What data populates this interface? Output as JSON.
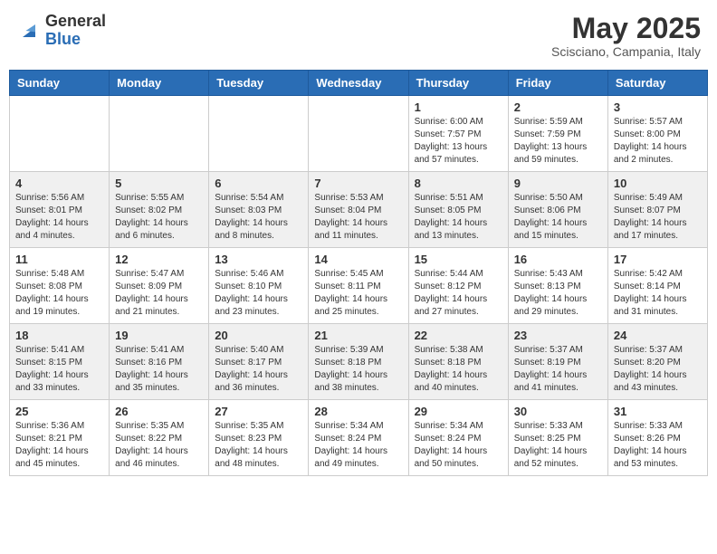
{
  "header": {
    "logo_general": "General",
    "logo_blue": "Blue",
    "month_year": "May 2025",
    "location": "Scisciano, Campania, Italy"
  },
  "calendar": {
    "days_of_week": [
      "Sunday",
      "Monday",
      "Tuesday",
      "Wednesday",
      "Thursday",
      "Friday",
      "Saturday"
    ],
    "weeks": [
      [
        {
          "day": "",
          "info": ""
        },
        {
          "day": "",
          "info": ""
        },
        {
          "day": "",
          "info": ""
        },
        {
          "day": "",
          "info": ""
        },
        {
          "day": "1",
          "info": "Sunrise: 6:00 AM\nSunset: 7:57 PM\nDaylight: 13 hours\nand 57 minutes."
        },
        {
          "day": "2",
          "info": "Sunrise: 5:59 AM\nSunset: 7:59 PM\nDaylight: 13 hours\nand 59 minutes."
        },
        {
          "day": "3",
          "info": "Sunrise: 5:57 AM\nSunset: 8:00 PM\nDaylight: 14 hours\nand 2 minutes."
        }
      ],
      [
        {
          "day": "4",
          "info": "Sunrise: 5:56 AM\nSunset: 8:01 PM\nDaylight: 14 hours\nand 4 minutes."
        },
        {
          "day": "5",
          "info": "Sunrise: 5:55 AM\nSunset: 8:02 PM\nDaylight: 14 hours\nand 6 minutes."
        },
        {
          "day": "6",
          "info": "Sunrise: 5:54 AM\nSunset: 8:03 PM\nDaylight: 14 hours\nand 8 minutes."
        },
        {
          "day": "7",
          "info": "Sunrise: 5:53 AM\nSunset: 8:04 PM\nDaylight: 14 hours\nand 11 minutes."
        },
        {
          "day": "8",
          "info": "Sunrise: 5:51 AM\nSunset: 8:05 PM\nDaylight: 14 hours\nand 13 minutes."
        },
        {
          "day": "9",
          "info": "Sunrise: 5:50 AM\nSunset: 8:06 PM\nDaylight: 14 hours\nand 15 minutes."
        },
        {
          "day": "10",
          "info": "Sunrise: 5:49 AM\nSunset: 8:07 PM\nDaylight: 14 hours\nand 17 minutes."
        }
      ],
      [
        {
          "day": "11",
          "info": "Sunrise: 5:48 AM\nSunset: 8:08 PM\nDaylight: 14 hours\nand 19 minutes."
        },
        {
          "day": "12",
          "info": "Sunrise: 5:47 AM\nSunset: 8:09 PM\nDaylight: 14 hours\nand 21 minutes."
        },
        {
          "day": "13",
          "info": "Sunrise: 5:46 AM\nSunset: 8:10 PM\nDaylight: 14 hours\nand 23 minutes."
        },
        {
          "day": "14",
          "info": "Sunrise: 5:45 AM\nSunset: 8:11 PM\nDaylight: 14 hours\nand 25 minutes."
        },
        {
          "day": "15",
          "info": "Sunrise: 5:44 AM\nSunset: 8:12 PM\nDaylight: 14 hours\nand 27 minutes."
        },
        {
          "day": "16",
          "info": "Sunrise: 5:43 AM\nSunset: 8:13 PM\nDaylight: 14 hours\nand 29 minutes."
        },
        {
          "day": "17",
          "info": "Sunrise: 5:42 AM\nSunset: 8:14 PM\nDaylight: 14 hours\nand 31 minutes."
        }
      ],
      [
        {
          "day": "18",
          "info": "Sunrise: 5:41 AM\nSunset: 8:15 PM\nDaylight: 14 hours\nand 33 minutes."
        },
        {
          "day": "19",
          "info": "Sunrise: 5:41 AM\nSunset: 8:16 PM\nDaylight: 14 hours\nand 35 minutes."
        },
        {
          "day": "20",
          "info": "Sunrise: 5:40 AM\nSunset: 8:17 PM\nDaylight: 14 hours\nand 36 minutes."
        },
        {
          "day": "21",
          "info": "Sunrise: 5:39 AM\nSunset: 8:18 PM\nDaylight: 14 hours\nand 38 minutes."
        },
        {
          "day": "22",
          "info": "Sunrise: 5:38 AM\nSunset: 8:18 PM\nDaylight: 14 hours\nand 40 minutes."
        },
        {
          "day": "23",
          "info": "Sunrise: 5:37 AM\nSunset: 8:19 PM\nDaylight: 14 hours\nand 41 minutes."
        },
        {
          "day": "24",
          "info": "Sunrise: 5:37 AM\nSunset: 8:20 PM\nDaylight: 14 hours\nand 43 minutes."
        }
      ],
      [
        {
          "day": "25",
          "info": "Sunrise: 5:36 AM\nSunset: 8:21 PM\nDaylight: 14 hours\nand 45 minutes."
        },
        {
          "day": "26",
          "info": "Sunrise: 5:35 AM\nSunset: 8:22 PM\nDaylight: 14 hours\nand 46 minutes."
        },
        {
          "day": "27",
          "info": "Sunrise: 5:35 AM\nSunset: 8:23 PM\nDaylight: 14 hours\nand 48 minutes."
        },
        {
          "day": "28",
          "info": "Sunrise: 5:34 AM\nSunset: 8:24 PM\nDaylight: 14 hours\nand 49 minutes."
        },
        {
          "day": "29",
          "info": "Sunrise: 5:34 AM\nSunset: 8:24 PM\nDaylight: 14 hours\nand 50 minutes."
        },
        {
          "day": "30",
          "info": "Sunrise: 5:33 AM\nSunset: 8:25 PM\nDaylight: 14 hours\nand 52 minutes."
        },
        {
          "day": "31",
          "info": "Sunrise: 5:33 AM\nSunset: 8:26 PM\nDaylight: 14 hours\nand 53 minutes."
        }
      ]
    ]
  }
}
